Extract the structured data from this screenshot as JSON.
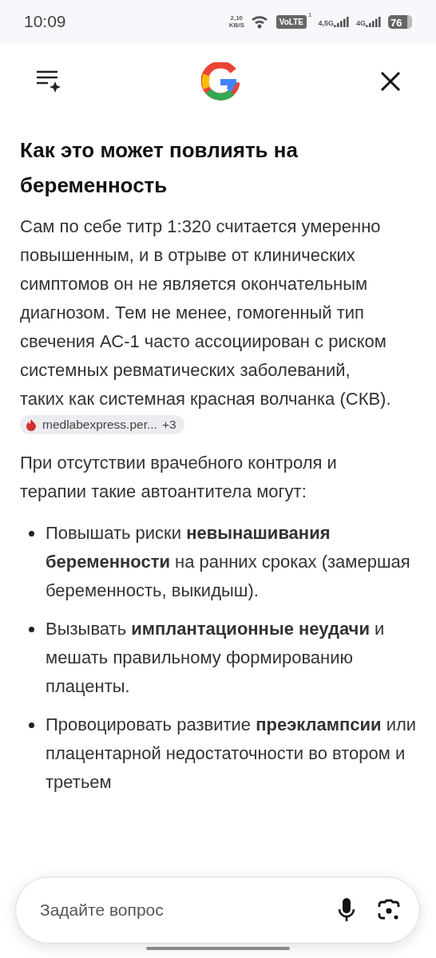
{
  "status_bar": {
    "time": "10:09",
    "speed_value": "2,10",
    "speed_unit": "KB/S",
    "volte": "VoLTE",
    "volte_sim": "1",
    "network_1": "4,5G",
    "network_2": "4G",
    "battery": "76"
  },
  "heading": "Как это может повлиять на беременность",
  "paragraph": "Сам по себе титр 1:320 считается умеренно повышенным, и в отрыве от клинических симптомов он не является окончательным диагнозом. Тем не менее, гомогенный тип свечения АС-1 часто ассоциирован с риском системных ревматических заболеваний, таких как системная красная волчанка (СКВ).",
  "source_chip": {
    "label": "medlabexpress.per...",
    "count": "+3"
  },
  "intro": "При отсутствии врачебного контроля и терапии такие автоантитела могут:",
  "bullets": [
    "Повышать риски **невынашивания беременности** на ранних сроках (замершая беременность, выкидыш).",
    "Вызывать **имплантационные неудачи** и мешать правильному формированию плаценты.",
    "Провоцировать развитие **преэклампсии** или плацентарной недостаточности во втором и третьем"
  ],
  "search": {
    "placeholder": "Задайте вопрос"
  }
}
